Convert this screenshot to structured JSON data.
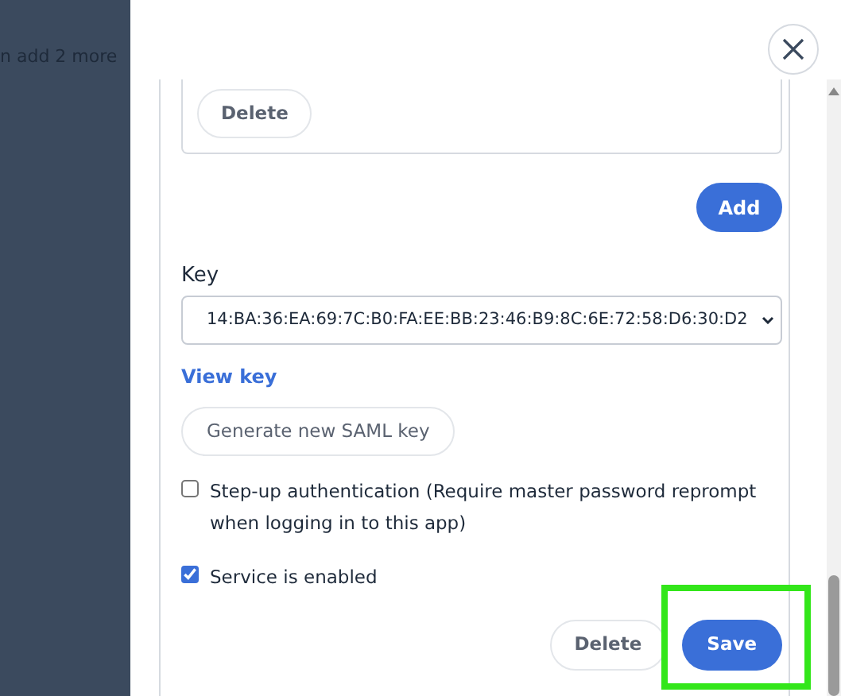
{
  "background": {
    "text": "n add 2 more"
  },
  "entry_card": {
    "buttons": [
      {
        "label": "Delete"
      }
    ]
  },
  "add_button": {
    "label": "Add"
  },
  "key": {
    "label": "Key",
    "value": "14:BA:36:EA:69:7C:B0:FA:EE:BB:23:46:B9:8C:6E:72:58:D6:30:D2"
  },
  "view_key_link": "View key",
  "generate_button": "Generate new SAML key",
  "options": [
    {
      "label": "Step-up authentication (Require master password reprompt when logging in to this app)",
      "checked": false
    },
    {
      "label": "Service is enabled",
      "checked": true
    }
  ],
  "footer_buttons": [
    {
      "label": "Delete",
      "kind": "secondary"
    },
    {
      "label": "Save",
      "kind": "primary",
      "highlighted": true
    }
  ]
}
